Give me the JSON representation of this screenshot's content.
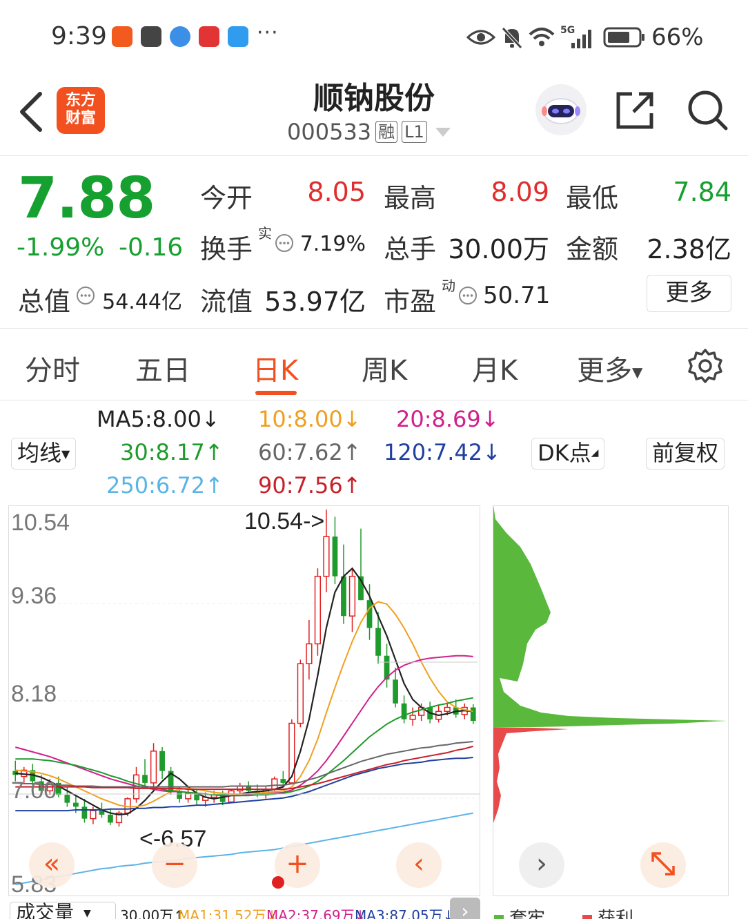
{
  "status_bar": {
    "time": "9:39",
    "notif_more": "···",
    "network": "5G",
    "battery": "66%"
  },
  "header": {
    "logo_line1": "东方",
    "logo_line2": "财富",
    "stock_name": "顺钠股份",
    "stock_code": "000533",
    "tag_margin": "融",
    "tag_level": "L1"
  },
  "quote": {
    "last_price": "7.88",
    "change_pct": "-1.99%",
    "change_amt": "-0.16",
    "open_label": "今开",
    "open": "8.05",
    "high_label": "最高",
    "high": "8.09",
    "low_label": "最低",
    "low": "7.84",
    "turnover_label": "换手",
    "turnover_sup": "实",
    "turnover": "7.19%",
    "volume_label": "总手",
    "volume": "30.00万",
    "amount_label": "金额",
    "amount": "2.38亿",
    "mktcap_label": "总值",
    "mktcap": "54.44亿",
    "float_label": "流值",
    "float_cap": "53.97亿",
    "pe_label": "市盈",
    "pe_sup": "动",
    "pe": "50.71",
    "more_button": "更多"
  },
  "tabs": {
    "items": [
      "分时",
      "五日",
      "日K",
      "周K",
      "月K",
      "更多"
    ],
    "active": "日K"
  },
  "ma_legend": {
    "ma_selector": "均线",
    "ma5": "MA5:8.00↓",
    "ma10": "10:8.00↓",
    "ma20": "20:8.69↓",
    "ma30": "30:8.17↑",
    "ma60": "60:7.62↑",
    "ma120": "120:7.42↓",
    "ma250": "250:6.72↑",
    "ma90": "90:7.56↑",
    "dk_button": "DK点",
    "adjust_button": "前复权",
    "colors": {
      "ma5": "#222222",
      "ma10": "#f0a020",
      "ma20": "#d0208c",
      "ma30": "#1f9a2c",
      "ma60": "#666666",
      "ma120": "#2040a0",
      "ma250": "#5ab4e6",
      "ma90": "#c8202a"
    }
  },
  "chart_data": {
    "type": "candlestick",
    "ylim": [
      5.83,
      10.54
    ],
    "y_ticks": [
      "10.54",
      "9.36",
      "8.18",
      "7.00",
      "5.83"
    ],
    "max_label": "10.54->",
    "min_label": "<-6.57",
    "candles": [
      [
        7.25,
        7.38,
        7.12,
        7.2
      ],
      [
        7.18,
        7.3,
        7.1,
        7.26
      ],
      [
        7.26,
        7.34,
        7.05,
        7.12
      ],
      [
        7.12,
        7.2,
        6.95,
        7.0
      ],
      [
        7.0,
        7.15,
        6.95,
        7.1
      ],
      [
        7.1,
        7.18,
        6.92,
        6.95
      ],
      [
        6.95,
        7.05,
        6.8,
        6.85
      ],
      [
        6.85,
        6.95,
        6.72,
        6.8
      ],
      [
        6.8,
        6.9,
        6.6,
        6.65
      ],
      [
        6.65,
        6.8,
        6.58,
        6.75
      ],
      [
        6.75,
        6.85,
        6.66,
        6.7
      ],
      [
        6.7,
        6.78,
        6.57,
        6.6
      ],
      [
        6.6,
        6.75,
        6.55,
        6.72
      ],
      [
        6.72,
        6.92,
        6.68,
        6.9
      ],
      [
        6.9,
        7.3,
        6.85,
        7.2
      ],
      [
        7.2,
        7.4,
        7.05,
        7.1
      ],
      [
        7.1,
        7.6,
        7.0,
        7.5
      ],
      [
        7.5,
        7.55,
        7.15,
        7.25
      ],
      [
        7.25,
        7.3,
        6.95,
        7.0
      ],
      [
        7.0,
        7.05,
        6.85,
        6.9
      ],
      [
        6.9,
        7.05,
        6.85,
        6.97
      ],
      [
        6.97,
        7.02,
        6.82,
        6.88
      ],
      [
        6.88,
        6.98,
        6.8,
        6.92
      ],
      [
        6.92,
        7.0,
        6.85,
        6.95
      ],
      [
        6.95,
        7.0,
        6.82,
        6.86
      ],
      [
        6.86,
        7.02,
        6.85,
        7.0
      ],
      [
        7.0,
        7.1,
        6.95,
        7.06
      ],
      [
        7.06,
        7.12,
        6.96,
        7.0
      ],
      [
        7.0,
        7.08,
        6.92,
        6.95
      ],
      [
        6.95,
        7.05,
        6.9,
        7.02
      ],
      [
        7.02,
        7.18,
        7.0,
        7.15
      ],
      [
        7.15,
        7.25,
        7.05,
        7.1
      ],
      [
        7.1,
        7.9,
        7.08,
        7.85
      ],
      [
        7.85,
        8.65,
        7.8,
        8.6
      ],
      [
        8.6,
        9.15,
        8.4,
        8.85
      ],
      [
        8.85,
        9.8,
        8.7,
        9.7
      ],
      [
        9.7,
        10.54,
        9.5,
        10.2
      ],
      [
        10.2,
        10.45,
        9.6,
        9.7
      ],
      [
        9.7,
        10.1,
        9.1,
        9.2
      ],
      [
        9.2,
        9.8,
        9.0,
        9.7
      ],
      [
        9.7,
        10.3,
        9.4,
        9.4
      ],
      [
        9.4,
        9.6,
        8.9,
        9.05
      ],
      [
        9.05,
        9.25,
        8.6,
        8.7
      ],
      [
        8.7,
        8.85,
        8.3,
        8.4
      ],
      [
        8.4,
        8.55,
        8.05,
        8.1
      ],
      [
        8.1,
        8.2,
        7.85,
        7.9
      ],
      [
        7.9,
        8.05,
        7.82,
        7.95
      ],
      [
        7.95,
        8.1,
        7.88,
        8.05
      ],
      [
        8.05,
        8.12,
        7.85,
        7.9
      ],
      [
        7.9,
        8.08,
        7.86,
        8.0
      ],
      [
        8.0,
        8.12,
        7.95,
        8.05
      ],
      [
        8.05,
        8.15,
        7.92,
        7.96
      ],
      [
        7.96,
        8.1,
        7.9,
        8.05
      ],
      [
        8.05,
        8.09,
        7.84,
        7.88
      ]
    ],
    "ma_lines": {
      "ma5": [
        7.22,
        7.21,
        7.2,
        7.17,
        7.12,
        7.06,
        7.0,
        6.94,
        6.88,
        6.82,
        6.76,
        6.72,
        6.7,
        6.71,
        6.78,
        6.88,
        7.0,
        7.12,
        7.22,
        7.15,
        7.05,
        6.97,
        6.92,
        6.9,
        6.92,
        6.94,
        6.96,
        6.98,
        6.99,
        7.0,
        7.02,
        7.05,
        7.18,
        7.5,
        7.9,
        8.45,
        9.05,
        9.5,
        9.7,
        9.8,
        9.65,
        9.45,
        9.2,
        8.95,
        8.65,
        8.35,
        8.15,
        8.05,
        7.98,
        7.95,
        7.97,
        8.0,
        8.01,
        8.0
      ],
      "ma10": [
        7.26,
        7.25,
        7.24,
        7.22,
        7.19,
        7.15,
        7.1,
        7.05,
        7.0,
        6.95,
        6.9,
        6.86,
        6.82,
        6.8,
        6.8,
        6.82,
        6.87,
        6.93,
        6.99,
        7.02,
        7.03,
        7.02,
        7.0,
        6.98,
        6.97,
        6.96,
        6.96,
        6.96,
        6.97,
        6.98,
        6.99,
        7.0,
        7.05,
        7.18,
        7.38,
        7.65,
        7.98,
        8.3,
        8.6,
        8.88,
        9.12,
        9.3,
        9.38,
        9.35,
        9.22,
        9.05,
        8.85,
        8.62,
        8.42,
        8.25,
        8.12,
        8.05,
        8.02,
        8.0
      ],
      "ma20": [
        7.55,
        7.52,
        7.49,
        7.46,
        7.43,
        7.39,
        7.35,
        7.31,
        7.27,
        7.23,
        7.19,
        7.15,
        7.12,
        7.09,
        7.06,
        7.04,
        7.02,
        7.0,
        6.99,
        6.99,
        6.98,
        6.97,
        6.96,
        6.95,
        6.94,
        6.94,
        6.94,
        6.95,
        6.96,
        6.96,
        6.97,
        6.98,
        7.01,
        7.07,
        7.15,
        7.25,
        7.38,
        7.53,
        7.69,
        7.85,
        8.01,
        8.17,
        8.31,
        8.43,
        8.52,
        8.58,
        8.62,
        8.65,
        8.67,
        8.68,
        8.69,
        8.7,
        8.7,
        8.69
      ],
      "ma30": [
        7.4,
        7.4,
        7.4,
        7.39,
        7.38,
        7.36,
        7.34,
        7.32,
        7.29,
        7.26,
        7.23,
        7.19,
        7.16,
        7.12,
        7.09,
        7.06,
        7.04,
        7.02,
        7.0,
        6.99,
        6.98,
        6.97,
        6.96,
        6.95,
        6.95,
        6.94,
        6.94,
        6.94,
        6.95,
        6.95,
        6.96,
        6.97,
        6.99,
        7.02,
        7.06,
        7.12,
        7.2,
        7.29,
        7.38,
        7.48,
        7.58,
        7.68,
        7.76,
        7.84,
        7.9,
        7.95,
        7.99,
        8.02,
        8.05,
        8.08,
        8.1,
        8.13,
        8.15,
        8.17
      ],
      "ma60": [
        7.1,
        7.09,
        7.09,
        7.08,
        7.08,
        7.07,
        7.07,
        7.06,
        7.06,
        7.06,
        7.05,
        7.05,
        7.05,
        7.05,
        7.05,
        7.05,
        7.05,
        7.05,
        7.05,
        7.05,
        7.05,
        7.05,
        7.05,
        7.05,
        7.05,
        7.06,
        7.06,
        7.06,
        7.06,
        7.06,
        7.07,
        7.07,
        7.09,
        7.11,
        7.14,
        7.17,
        7.21,
        7.25,
        7.29,
        7.33,
        7.37,
        7.4,
        7.43,
        7.46,
        7.48,
        7.5,
        7.52,
        7.54,
        7.55,
        7.57,
        7.58,
        7.6,
        7.61,
        7.62
      ],
      "ma90": [
        7.05,
        7.05,
        7.05,
        7.05,
        7.05,
        7.05,
        7.05,
        7.05,
        7.05,
        7.04,
        7.04,
        7.04,
        7.04,
        7.04,
        7.03,
        7.03,
        7.03,
        7.03,
        7.03,
        7.03,
        7.02,
        7.02,
        7.02,
        7.02,
        7.02,
        7.02,
        7.02,
        7.02,
        7.02,
        7.02,
        7.02,
        7.02,
        7.03,
        7.05,
        7.07,
        7.09,
        7.12,
        7.15,
        7.18,
        7.21,
        7.24,
        7.27,
        7.3,
        7.33,
        7.35,
        7.38,
        7.4,
        7.42,
        7.44,
        7.46,
        7.48,
        7.51,
        7.53,
        7.56
      ],
      "ma120": [
        6.75,
        6.75,
        6.75,
        6.75,
        6.75,
        6.75,
        6.75,
        6.76,
        6.76,
        6.76,
        6.76,
        6.77,
        6.77,
        6.77,
        6.78,
        6.78,
        6.79,
        6.79,
        6.8,
        6.8,
        6.81,
        6.82,
        6.82,
        6.83,
        6.84,
        6.85,
        6.86,
        6.87,
        6.88,
        6.89,
        6.9,
        6.91,
        6.93,
        6.96,
        6.99,
        7.03,
        7.07,
        7.11,
        7.15,
        7.19,
        7.22,
        7.25,
        7.28,
        7.3,
        7.32,
        7.34,
        7.35,
        7.36,
        7.38,
        7.39,
        7.4,
        7.41,
        7.41,
        7.42
      ],
      "ma250": [
        5.82,
        5.84,
        5.86,
        5.88,
        5.9,
        5.92,
        5.94,
        5.96,
        5.98,
        6.0,
        6.02,
        6.03,
        6.05,
        6.06,
        6.07,
        6.09,
        6.1,
        6.11,
        6.12,
        6.13,
        6.15,
        6.16,
        6.17,
        6.18,
        6.19,
        6.2,
        6.22,
        6.23,
        6.24,
        6.25,
        6.26,
        6.28,
        6.3,
        6.32,
        6.34,
        6.36,
        6.38,
        6.4,
        6.42,
        6.44,
        6.46,
        6.48,
        6.5,
        6.52,
        6.54,
        6.56,
        6.58,
        6.6,
        6.62,
        6.64,
        6.66,
        6.68,
        6.7,
        6.72
      ]
    }
  },
  "chip_data": {
    "type": "histogram",
    "profit_color": "#5ab83c",
    "trapped_color": "#e84a4a"
  },
  "bottom": {
    "volume_selector": "成交量",
    "vol": "30.00万↑",
    "vma1": "MA1:31.52万↓",
    "vma2": "MA2:37.69万↓",
    "vma3": "MA3:87.05万↓",
    "chip_profit": "套牢",
    "chip_trapped": "获利"
  }
}
